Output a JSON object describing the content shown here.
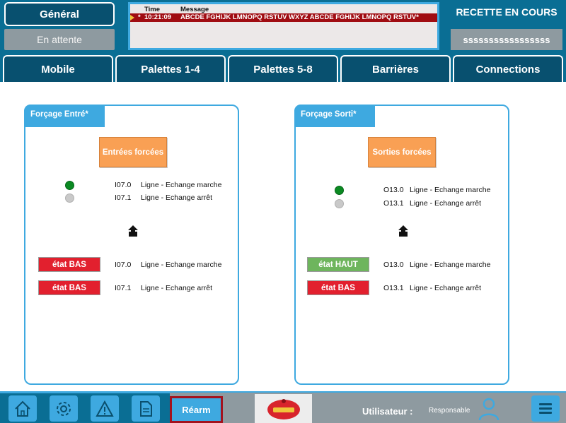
{
  "header": {
    "mode_button": "Général",
    "status_button": "En attente",
    "recette_status": "RECETTE EN COURS",
    "user_field": "sssssssssssssssss"
  },
  "alarms": {
    "col_time": "Time",
    "col_message": "Message",
    "rows": [
      {
        "marker": "*",
        "time": "10:21:09",
        "message": "ABCDE FGHIJK LMNOPQ RSTUV WXYZ ABCDE FGHIJK LMNOPQ RSTUV*"
      }
    ]
  },
  "nav": {
    "tabs": [
      {
        "label": "Mobile"
      },
      {
        "label": "Palettes 1-4"
      },
      {
        "label": "Palettes 5-8"
      },
      {
        "label": "Barrières"
      },
      {
        "label": "Connections"
      }
    ]
  },
  "panels": {
    "entree": {
      "title": "Forçage Entré*",
      "button": "Entrées forcées",
      "status": [
        {
          "state": "on",
          "address": "I07.0",
          "label": "Ligne - Echange marche"
        },
        {
          "state": "off",
          "address": "I07.1",
          "label": "Ligne - Echange arrêt"
        }
      ],
      "forces": [
        {
          "button": "état BAS",
          "kind": "bas",
          "address": "I07.0",
          "label": "Ligne - Echange marche"
        },
        {
          "button": "état BAS",
          "kind": "bas",
          "address": "I07.1",
          "label": "Ligne - Echange arrêt"
        }
      ]
    },
    "sortie": {
      "title": "Forçage Sorti*",
      "button": "Sorties forcées",
      "status": [
        {
          "state": "on",
          "address": "O13.0",
          "label": "Ligne - Echange marche"
        },
        {
          "state": "off",
          "address": "O13.1",
          "label": "Ligne - Echange arrêt"
        }
      ],
      "forces": [
        {
          "button": "état HAUT",
          "kind": "haut",
          "address": "O13.0",
          "label": "Ligne - Echange marche"
        },
        {
          "button": "état BAS",
          "kind": "bas",
          "address": "O13.1",
          "label": "Ligne - Echange arrêt"
        }
      ]
    }
  },
  "footer": {
    "rearm_button": "Réarm",
    "user_label": "Utilisateur :",
    "user_role": "Responsable",
    "icons": [
      "home-icon",
      "settings-icon",
      "alarm-warning-icon",
      "document-icon",
      "menu-icon"
    ]
  },
  "colors": {
    "header_bg": "#0a6e94",
    "accent": "#3ea9e0",
    "alarm_active": "#a00c12",
    "led_on": "#0b8a22",
    "led_off": "#c9c9c9",
    "force_low": "#e2202e",
    "force_high": "#6eb55d",
    "action_orange": "#f9a054"
  }
}
